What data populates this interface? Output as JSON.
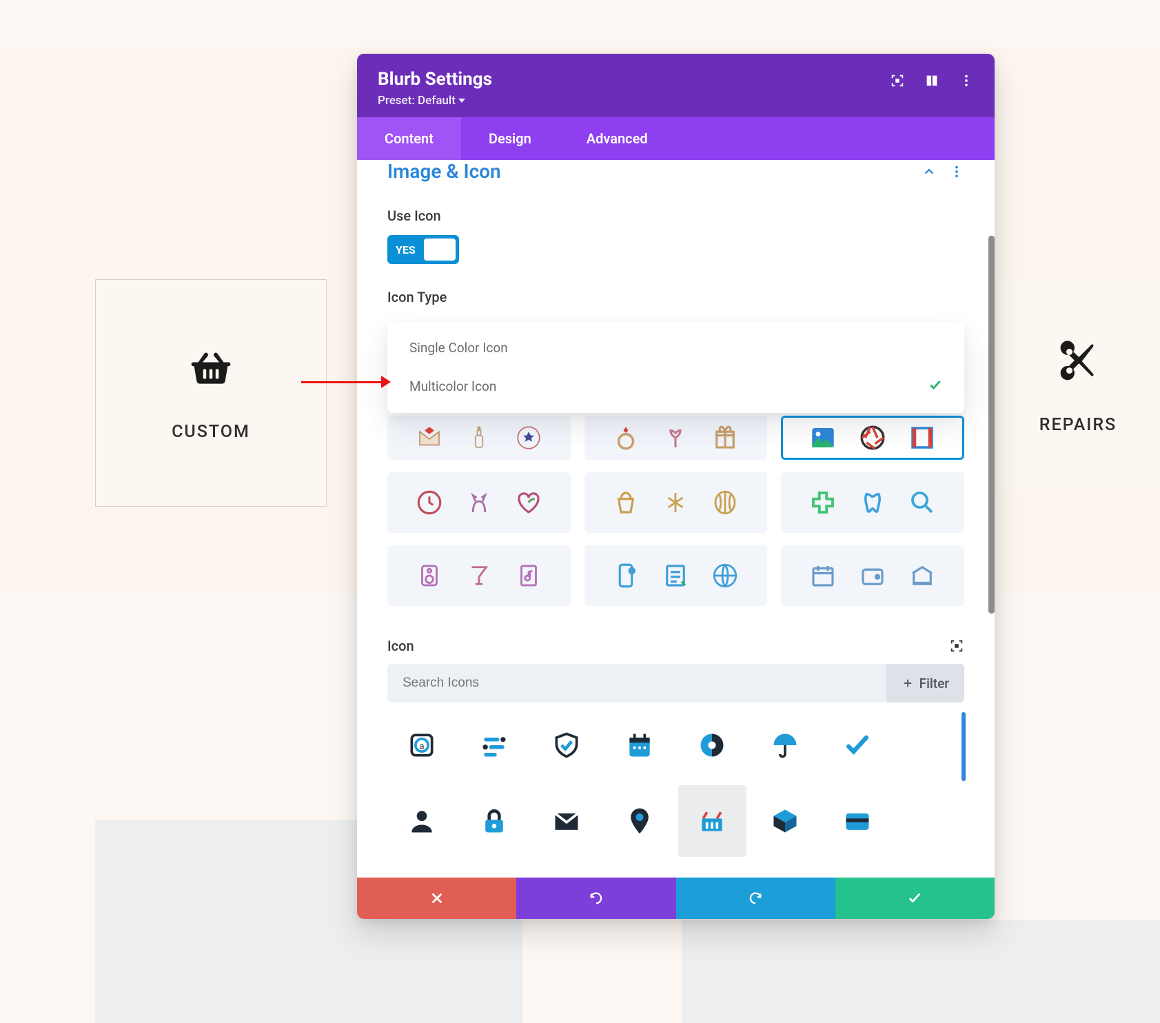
{
  "header": {
    "title": "Blurb Settings",
    "preset_label": "Preset: Default"
  },
  "tabs": [
    "Content",
    "Design",
    "Advanced"
  ],
  "active_tab": 0,
  "section": {
    "title": "Image & Icon",
    "use_icon_label": "Use Icon",
    "toggle_value": "YES",
    "icon_type_label": "Icon Type",
    "dropdown_options": [
      {
        "label": "Single Color Icon",
        "selected": false
      },
      {
        "label": "Multicolor Icon",
        "selected": true
      }
    ]
  },
  "icon_section": {
    "heading": "Icon",
    "search_placeholder": "Search Icons",
    "filter_label": "Filter"
  },
  "background_cards": {
    "left_label": "CUSTOM",
    "right_label": "REPAIRS"
  }
}
